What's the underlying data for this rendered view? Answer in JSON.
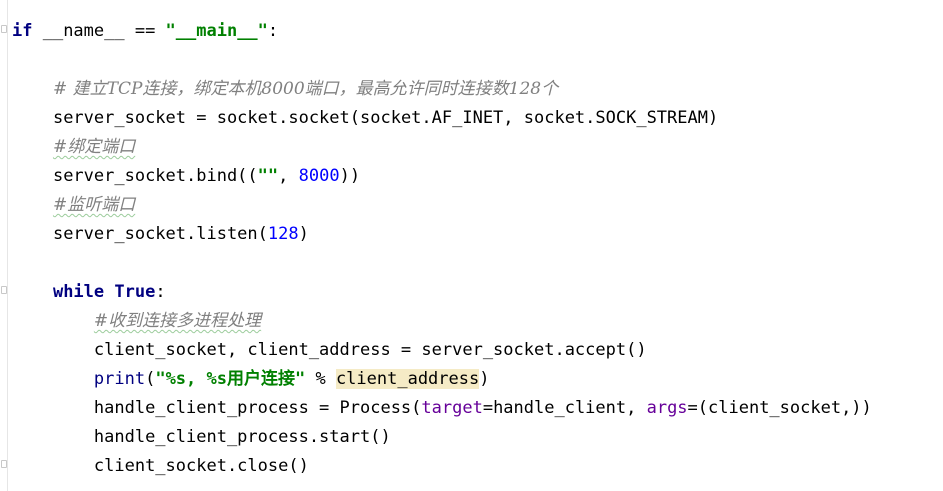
{
  "editor": {
    "lines": [
      {
        "indent": "",
        "t1": "if",
        "t2": " __name__ == ",
        "t3": "\"__main__\"",
        "t4": ":"
      },
      {
        "indent": "    ",
        "comment": "# 建立TCP连接，绑定本机8000端口，最高允许同时连接数128个"
      },
      {
        "indent": "    ",
        "text": "server_socket = socket.socket(socket.AF_INET, socket.SOCK_STREAM)"
      },
      {
        "indent": "    ",
        "comment": "#绑定端口"
      },
      {
        "indent": "    ",
        "t1": "server_socket.bind((",
        "t2": "\"\"",
        "t3": ", ",
        "t4": "8000",
        "t5": "))"
      },
      {
        "indent": "    ",
        "comment": "#监听端口"
      },
      {
        "indent": "    ",
        "t1": "server_socket.listen(",
        "t2": "128",
        "t3": ")"
      },
      {
        "indent": "    ",
        "t1": "while",
        "t2": " ",
        "t3": "True",
        "t4": ":"
      },
      {
        "indent": "        ",
        "comment": "#收到连接多进程处理"
      },
      {
        "indent": "        ",
        "text": "client_socket, client_address = server_socket.accept()"
      },
      {
        "indent": "        ",
        "t1": "print",
        "t2": "(",
        "t3": "\"%s, %s用户连接\"",
        "t4": " % ",
        "t5": "client_address",
        "t6": ")"
      },
      {
        "indent": "        ",
        "t1": "handle_client_process = Process(",
        "t2": "target",
        "t3": "=handle_client, ",
        "t4": "args",
        "t5": "=(client_socket,))"
      },
      {
        "indent": "        ",
        "text": "handle_client_process.start()"
      },
      {
        "indent": "        ",
        "text": "client_socket.close()"
      }
    ]
  },
  "colors": {
    "keyword": "#000080",
    "string": "#008000",
    "number": "#0000ff",
    "comment": "#808080",
    "param": "#660099",
    "highlight": "#f5ebc6"
  }
}
